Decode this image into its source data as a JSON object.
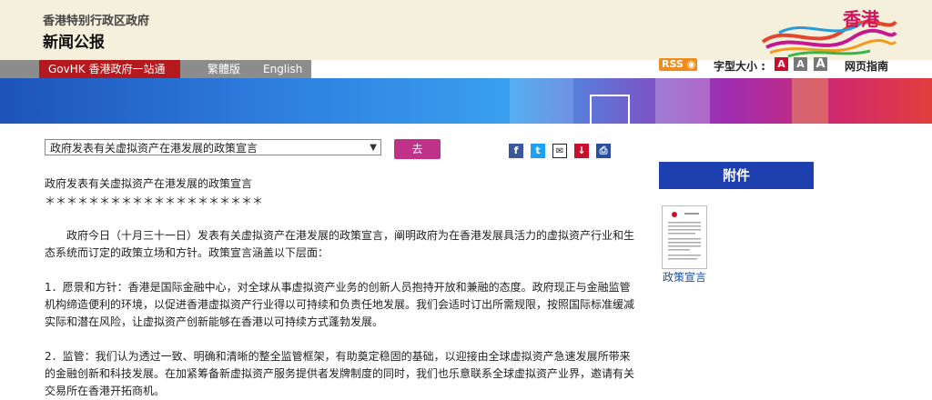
{
  "header": {
    "site_sub": "香港特别行政区政府",
    "site_title": "新闻公报",
    "logo_text": "香港"
  },
  "nav": {
    "govhk": "GovHK 香港政府一站通",
    "trad": "繁體版",
    "english": "English"
  },
  "tools": {
    "rss": "RSS",
    "font_size_label": "字型大小 :",
    "font_buttons": [
      "A",
      "A",
      "A"
    ],
    "page_guide": "网页指南"
  },
  "selector": {
    "value": "政府发表有关虚拟资产在港发展的政策宣言",
    "go_label": "去"
  },
  "article": {
    "title": "政府发表有关虚拟资产在港发展的政策宣言",
    "stars": "＊＊＊＊＊＊＊＊＊＊＊＊＊＊＊＊＊＊＊＊",
    "para1": "　　政府今日（十月三十一日）发表有关虚拟资产在港发展的政策宣言，阐明政府为在香港发展具活力的虚拟资产行业和生态系统而订定的政策立场和方针。政策宣言涵盖以下层面：",
    "para2": "1．愿景和方针：香港是国际金融中心，对全球从事虚拟资产业务的创新人员抱持开放和兼融的态度。政府现正与金融监管机构缔造便利的环境，以促进香港虚拟资产行业得以可持续和负责任地发展。我们会适时订出所需规限，按照国际标准缓减实际和潜在风险，让虚拟资产创新能够在香港以可持续方式蓬勃发展。",
    "para3": "2．监管：我们认为透过一致、明确和清晰的整全监管框架，有助奠定稳固的基础，以迎接由全球虚拟资产急速发展所带来的金融创新和科技发展。在加紧筹备新虚拟资产服务提供者发牌制度的同时，我们也乐意联系全球虚拟资产业界，邀请有关交易所在香港开拓商机。"
  },
  "attachments": {
    "heading": "附件",
    "link_label": "政策宣言"
  },
  "colors": {
    "brand_red": "#b5191d",
    "go_button": "#c0328a",
    "attachment_blue": "#1e3fb0"
  }
}
